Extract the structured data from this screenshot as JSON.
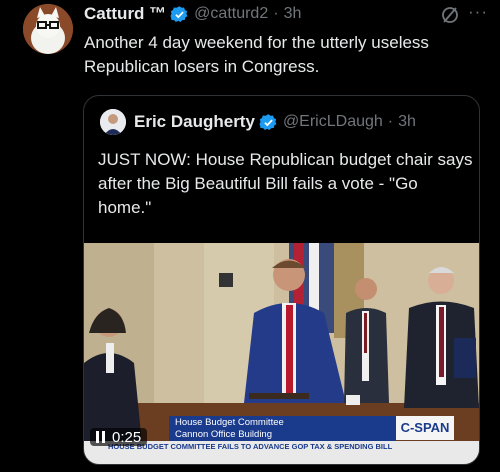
{
  "post": {
    "author_name": "Catturd ™",
    "handle": "@catturd2",
    "time": "3h",
    "more_label": "···",
    "text": "Another 4 day weekend for the utterly useless Republican losers in Congress."
  },
  "quote": {
    "author_name": "Eric Daugherty",
    "handle": "@EricLDaugh",
    "time": "3h",
    "text": "JUST NOW: House Republican budget chair says after the Big Beautiful Bill fails a vote - \"Go home.\""
  },
  "video": {
    "timestamp": "0:25",
    "lower_third_line1": "House Budget Committee",
    "lower_third_line2": "Cannon Office Building",
    "network": "C-SPAN",
    "ticker": "HOUSE BUDGET COMMITTEE FAILS TO ADVANCE GOP TAX & SPENDING BILL"
  },
  "colors": {
    "background": "#000000",
    "text": "#e7e9ea",
    "muted": "#71767b",
    "verified": "#1d9bf0",
    "cspan_blue": "#1a3a8c"
  }
}
